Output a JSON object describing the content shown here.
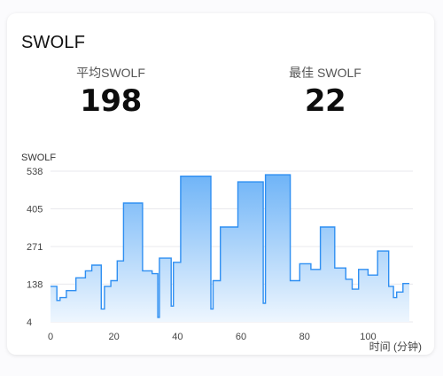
{
  "card": {
    "title": "SWOLF"
  },
  "stats": {
    "average": {
      "label": "平均SWOLF",
      "value": "198"
    },
    "best": {
      "label": "最佳 SWOLF",
      "value": "22"
    }
  },
  "colors": {
    "line": "#2f8ff2",
    "fill_top": "#6fb4f7",
    "fill_bottom": "#eef6fe",
    "grid": "#e8e8ec",
    "tick_text": "#444444"
  },
  "chart_data": {
    "type": "area",
    "title": "",
    "xlabel": "时间 (分钟)",
    "ylabel": "SWOLF",
    "xlim": [
      0,
      113
    ],
    "ylim": [
      4,
      538
    ],
    "grid": true,
    "x_ticks": [
      0,
      20,
      40,
      60,
      80,
      100
    ],
    "y_ticks": [
      538,
      405,
      271,
      138,
      4
    ],
    "series": [
      {
        "step": true,
        "points": [
          [
            0,
            130
          ],
          [
            2,
            80
          ],
          [
            3,
            90
          ],
          [
            5,
            115
          ],
          [
            8,
            160
          ],
          [
            11,
            185
          ],
          [
            13,
            205
          ],
          [
            16,
            50
          ],
          [
            17,
            130
          ],
          [
            19,
            150
          ],
          [
            21,
            220
          ],
          [
            23,
            425
          ],
          [
            29,
            185
          ],
          [
            32,
            175
          ],
          [
            33.8,
            20
          ],
          [
            34.3,
            230
          ],
          [
            38,
            60
          ],
          [
            38.7,
            215
          ],
          [
            41,
            520
          ],
          [
            50.5,
            50
          ],
          [
            51.2,
            150
          ],
          [
            53.5,
            340
          ],
          [
            59,
            500
          ],
          [
            67,
            70
          ],
          [
            67.7,
            525
          ],
          [
            75.5,
            150
          ],
          [
            78.5,
            210
          ],
          [
            82,
            190
          ],
          [
            85,
            340
          ],
          [
            89.5,
            195
          ],
          [
            93,
            155
          ],
          [
            95,
            120
          ],
          [
            97,
            190
          ],
          [
            100,
            170
          ],
          [
            103,
            255
          ],
          [
            106.5,
            130
          ],
          [
            108,
            90
          ],
          [
            109,
            110
          ],
          [
            111,
            140
          ],
          [
            113,
            140
          ]
        ]
      }
    ]
  }
}
